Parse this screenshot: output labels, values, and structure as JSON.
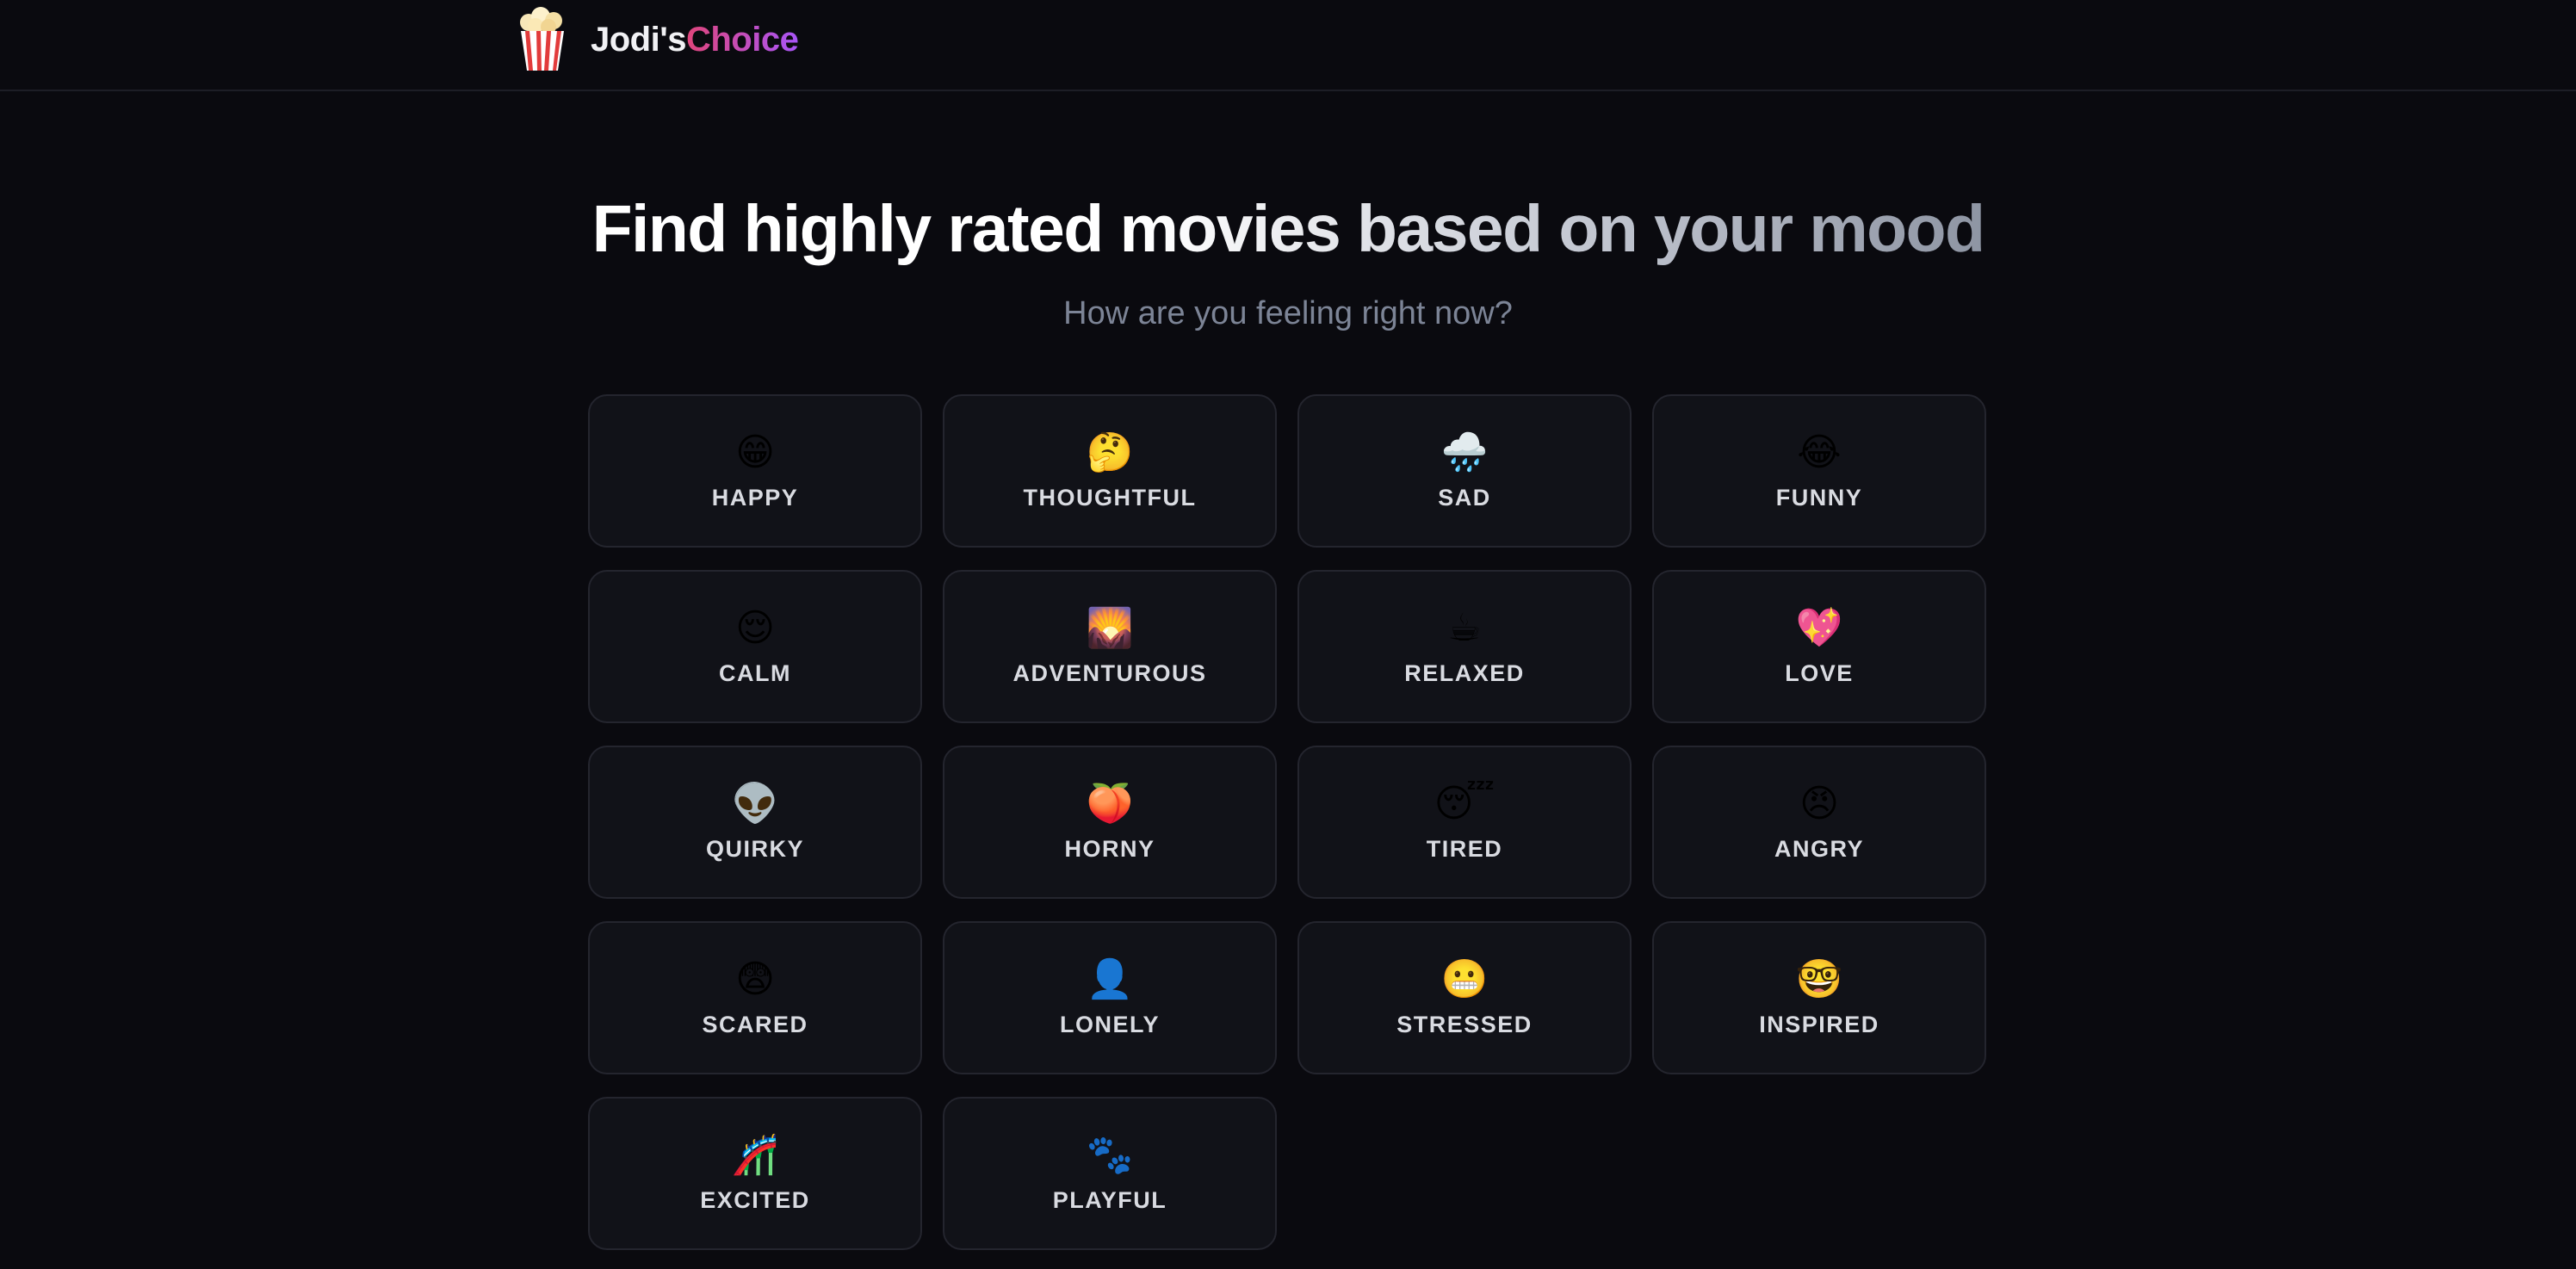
{
  "header": {
    "brand_part1": "Jodi's",
    "brand_part2": "Choice",
    "logo_icon": "popcorn-icon"
  },
  "hero": {
    "title": "Find highly rated movies based on your mood",
    "subtitle": "How are you feeling right now?"
  },
  "moods": [
    {
      "emoji": "😁",
      "label": "HAPPY",
      "icon": "happy-face-icon"
    },
    {
      "emoji": "🤔",
      "label": "THOUGHTFUL",
      "icon": "thinking-face-icon"
    },
    {
      "emoji": "🌧️",
      "label": "SAD",
      "icon": "rain-cloud-icon"
    },
    {
      "emoji": "😂",
      "label": "FUNNY",
      "icon": "tears-of-joy-icon"
    },
    {
      "emoji": "😌",
      "label": "CALM",
      "icon": "relieved-face-icon"
    },
    {
      "emoji": "🌄",
      "label": "ADVENTUROUS",
      "icon": "sunrise-mountains-icon"
    },
    {
      "emoji": "☕",
      "label": "RELAXED",
      "icon": "coffee-icon"
    },
    {
      "emoji": "💖",
      "label": "LOVE",
      "icon": "sparkling-heart-icon"
    },
    {
      "emoji": "👽",
      "label": "QUIRKY",
      "icon": "alien-icon"
    },
    {
      "emoji": "🍑",
      "label": "HORNY",
      "icon": "peach-icon"
    },
    {
      "emoji": "😴",
      "label": "TIRED",
      "icon": "sleeping-face-icon"
    },
    {
      "emoji": "😠",
      "label": "ANGRY",
      "icon": "angry-face-icon"
    },
    {
      "emoji": "😨",
      "label": "SCARED",
      "icon": "fearful-face-icon"
    },
    {
      "emoji": "👤",
      "label": "LONELY",
      "icon": "silhouette-icon"
    },
    {
      "emoji": "😬",
      "label": "STRESSED",
      "icon": "grimacing-face-icon"
    },
    {
      "emoji": "🤓",
      "label": "INSPIRED",
      "icon": "nerd-face-icon"
    },
    {
      "emoji": "🎢",
      "label": "EXCITED",
      "icon": "roller-coaster-icon"
    },
    {
      "emoji": "🐾",
      "label": "PLAYFUL",
      "icon": "paw-prints-icon"
    }
  ]
}
